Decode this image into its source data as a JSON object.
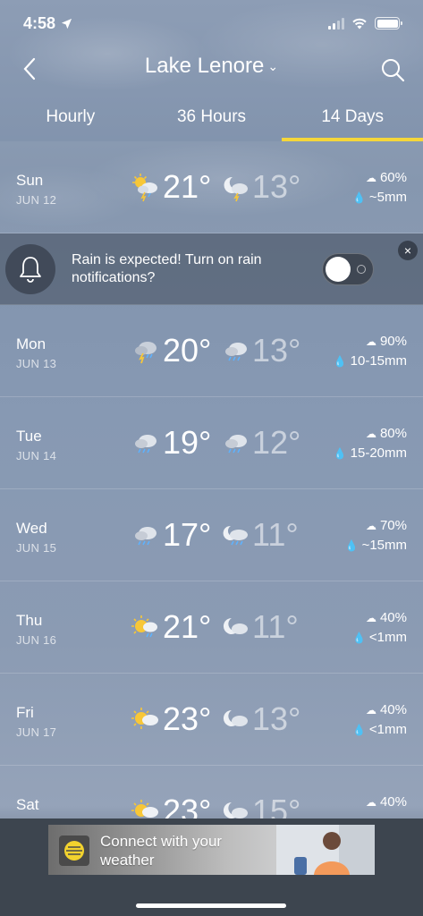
{
  "status": {
    "time": "4:58"
  },
  "header": {
    "title": "Lake Lenore"
  },
  "tabs": [
    {
      "label": "Hourly"
    },
    {
      "label": "36 Hours"
    },
    {
      "label": "14 Days"
    }
  ],
  "notification": {
    "text": "Rain is expected! Turn on rain notifications?",
    "close_label": "×"
  },
  "days": [
    {
      "day": "Sun",
      "date": "JUN 12",
      "hi": "21°",
      "lo": "13°",
      "chance": "60%",
      "amount": "~5mm",
      "day_icon": "sun-thunderstorm-icon",
      "night_icon": "moon-thunderstorm-icon"
    },
    {
      "day": "Mon",
      "date": "JUN 13",
      "hi": "20°",
      "lo": "13°",
      "chance": "90%",
      "amount": "10-15mm",
      "day_icon": "thunderstorm-icon",
      "night_icon": "rain-cloud-icon"
    },
    {
      "day": "Tue",
      "date": "JUN 14",
      "hi": "19°",
      "lo": "12°",
      "chance": "80%",
      "amount": "15-20mm",
      "day_icon": "rain-cloud-icon",
      "night_icon": "rain-cloud-icon"
    },
    {
      "day": "Wed",
      "date": "JUN 15",
      "hi": "17°",
      "lo": "11°",
      "chance": "70%",
      "amount": "~15mm",
      "day_icon": "rain-cloud-icon",
      "night_icon": "moon-rain-icon"
    },
    {
      "day": "Thu",
      "date": "JUN 16",
      "hi": "21°",
      "lo": "11°",
      "chance": "40%",
      "amount": "<1mm",
      "day_icon": "sun-rain-icon",
      "night_icon": "moon-cloud-icon"
    },
    {
      "day": "Fri",
      "date": "JUN 17",
      "hi": "23°",
      "lo": "13°",
      "chance": "40%",
      "amount": "<1mm",
      "day_icon": "sun-cloud-icon",
      "night_icon": "moon-cloud-icon"
    },
    {
      "day": "Sat",
      "date": "",
      "hi": "23°",
      "lo": "15°",
      "chance": "40%",
      "amount": "",
      "day_icon": "sun-cloud-icon",
      "night_icon": "moon-cloud-icon"
    }
  ],
  "ad": {
    "text": "Connect with your weather"
  },
  "colors": {
    "accent": "#f5d63a",
    "drop": "#8ec8ff"
  }
}
